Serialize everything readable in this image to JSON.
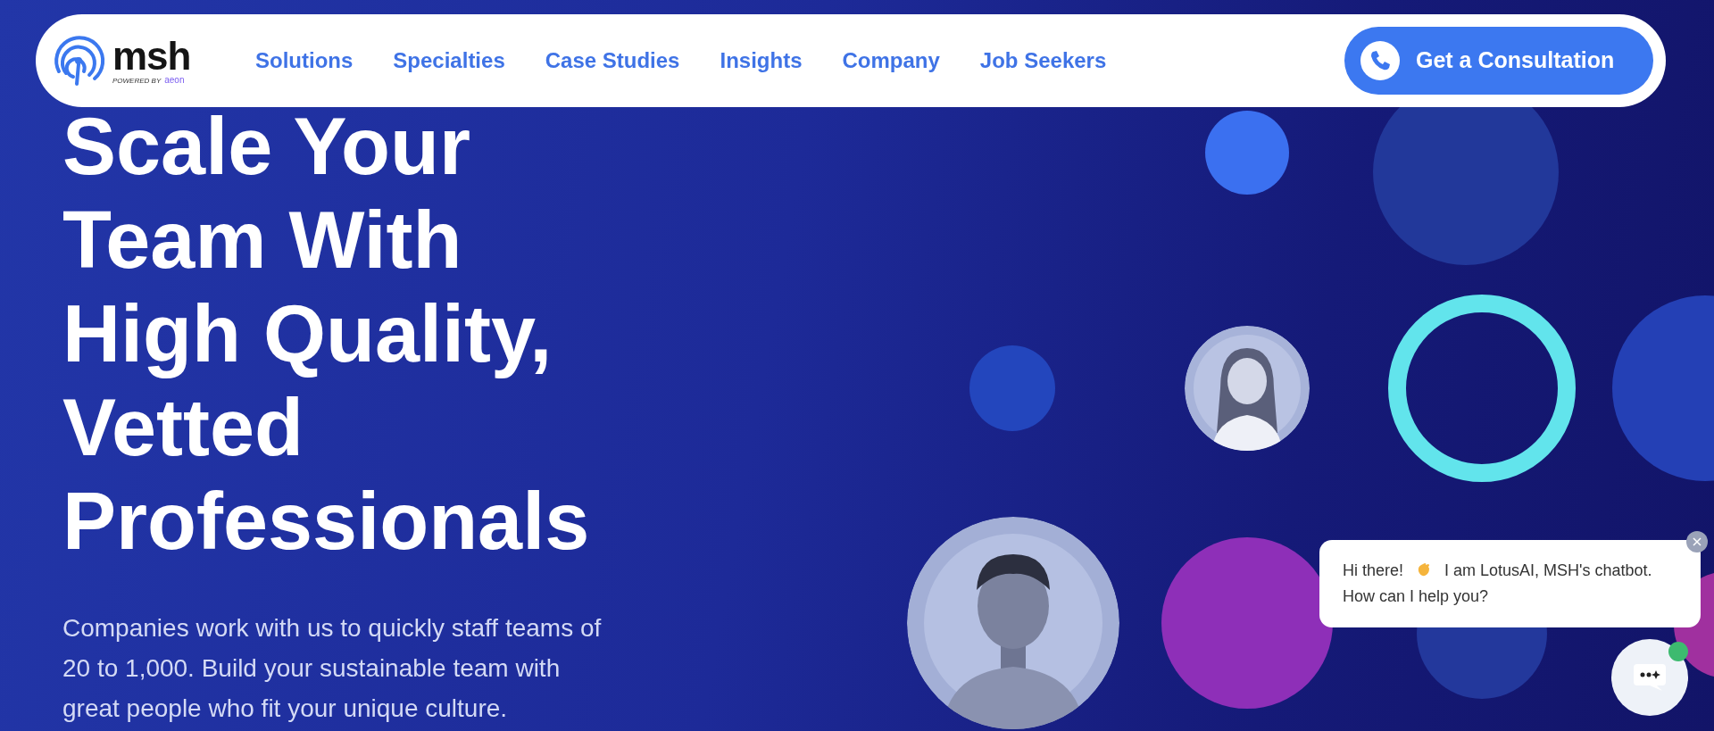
{
  "header": {
    "logo": {
      "wordmark": "msh",
      "tagline": "POWERED BY",
      "partner": "aeon"
    },
    "nav_links": [
      "Solutions",
      "Specialties",
      "Case Studies",
      "Insights",
      "Company",
      "Job Seekers"
    ],
    "cta": "Get a Consultation"
  },
  "hero": {
    "heading_lines": [
      "Scale Your",
      "Team With",
      "High Quality,",
      "Vetted",
      "Professionals"
    ],
    "body_lines": [
      "Companies work with us to quickly staff teams of",
      "20 to 1,000. Build your sustainable team with",
      "great people who fit your unique culture."
    ]
  },
  "chat": {
    "greeting": "Hi there!",
    "message": "I am LotusAI, MSH's chatbot.",
    "question": "How can I help you?",
    "online": true
  }
}
